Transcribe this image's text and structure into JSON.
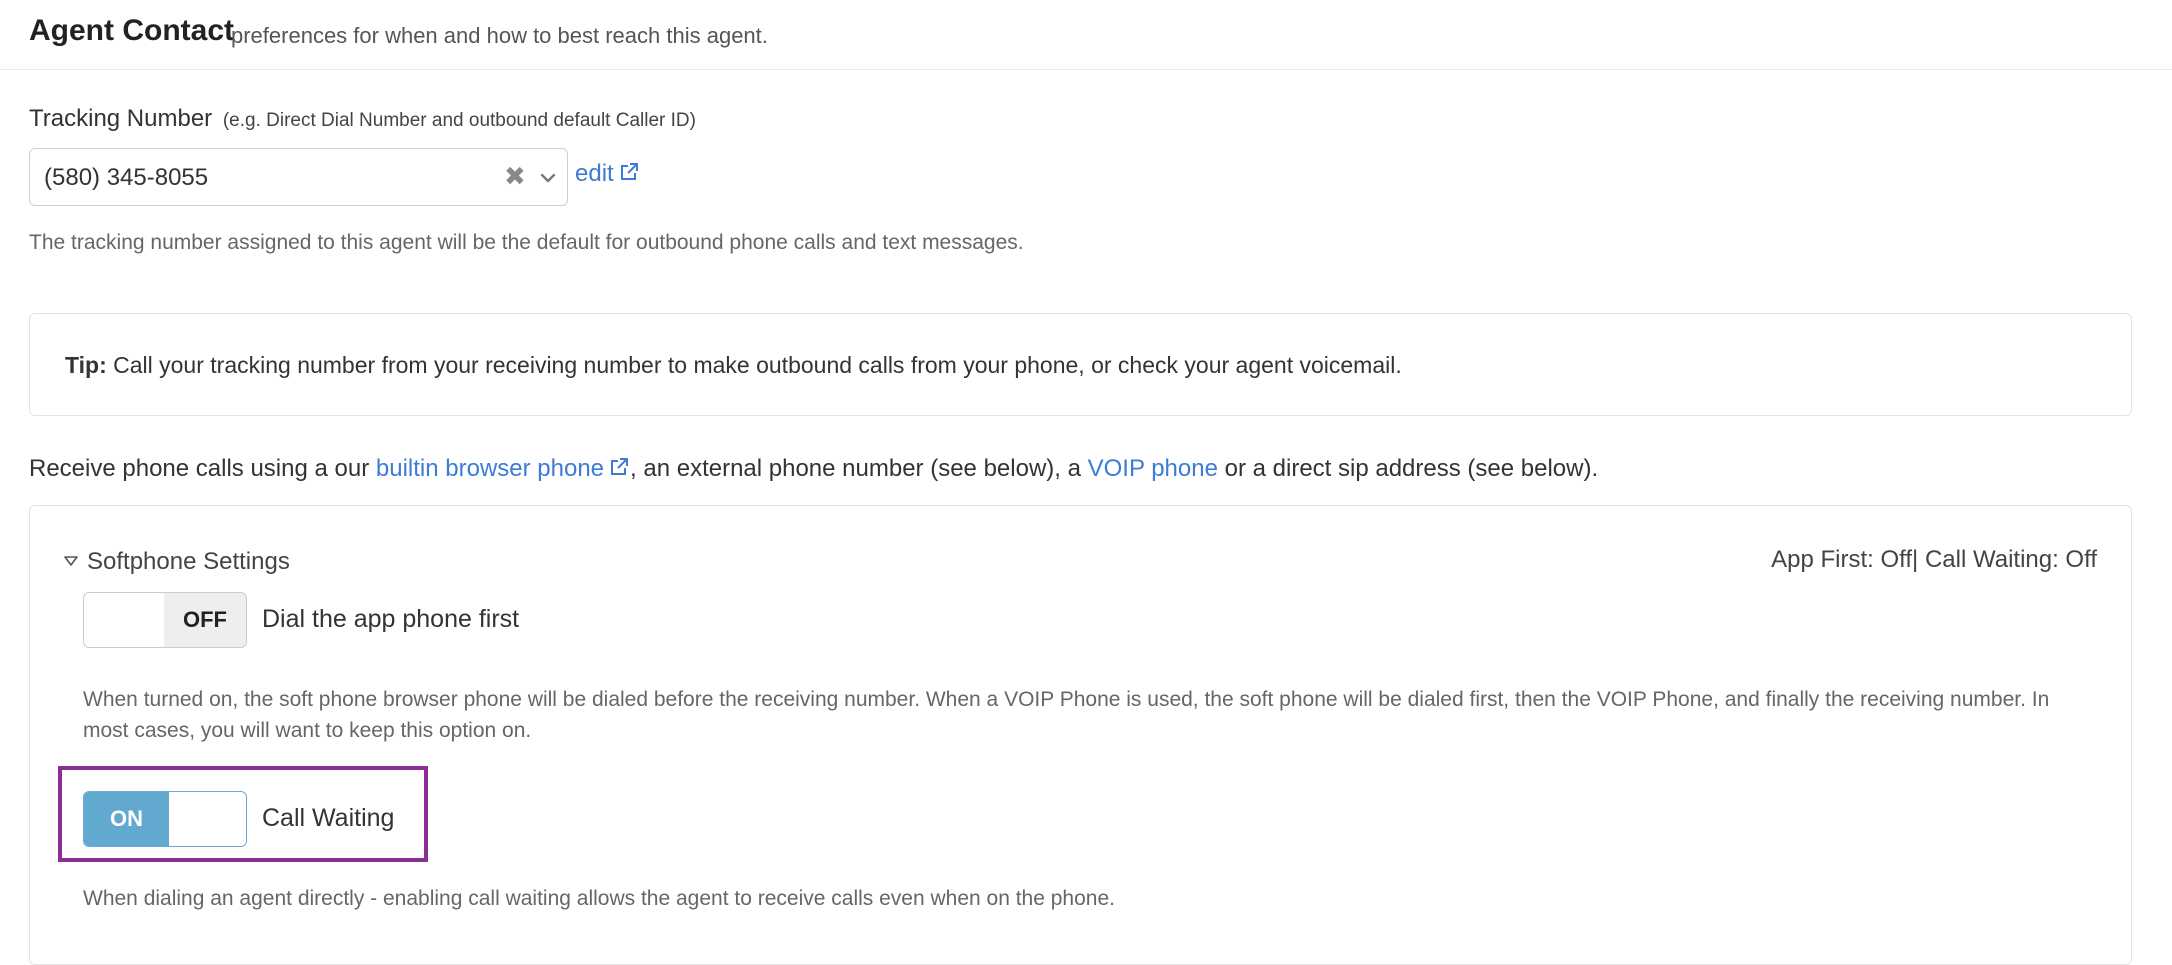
{
  "header": {
    "title": "Agent Contact",
    "subtitle": "preferences for when and how to best reach this agent."
  },
  "tracking": {
    "label": "Tracking Number",
    "hint": "(e.g. Direct Dial Number and outbound default Caller ID)",
    "value": "(580) 345-8055",
    "clear_glyph": "✖",
    "edit_label": "edit",
    "help": "The tracking number assigned to this agent will be the default for outbound phone calls and text messages."
  },
  "tip": {
    "bold": "Tip:",
    "text": " Call your tracking number from your receiving number to make outbound calls from your phone, or check your agent voicemail."
  },
  "receive": {
    "part1": "Receive phone calls using a our ",
    "link1": "builtin browser phone",
    "part2": ", an external phone number (see below), a ",
    "link2": "VOIP phone",
    "part3": " or a direct sip address (see below)."
  },
  "softphone": {
    "title": "Softphone Settings",
    "summary": "App First: Off| Call Waiting: Off",
    "app_first": {
      "state_label": "OFF",
      "label": "Dial the app phone first",
      "help": "When turned on, the soft phone browser phone will be dialed before the receiving number. When a VOIP Phone is used, the soft phone will be dialed first, then the VOIP Phone, and finally the receiving number. In most cases, you will want to keep this option on."
    },
    "call_waiting": {
      "state_label": "ON",
      "label": "Call Waiting",
      "help": "When dialing an agent directly - enabling call waiting allows the agent to receive calls even when on the phone."
    }
  },
  "colors": {
    "link": "#3d7bd6",
    "switch_on": "#61a9cf",
    "highlight": "#8b2c97"
  }
}
